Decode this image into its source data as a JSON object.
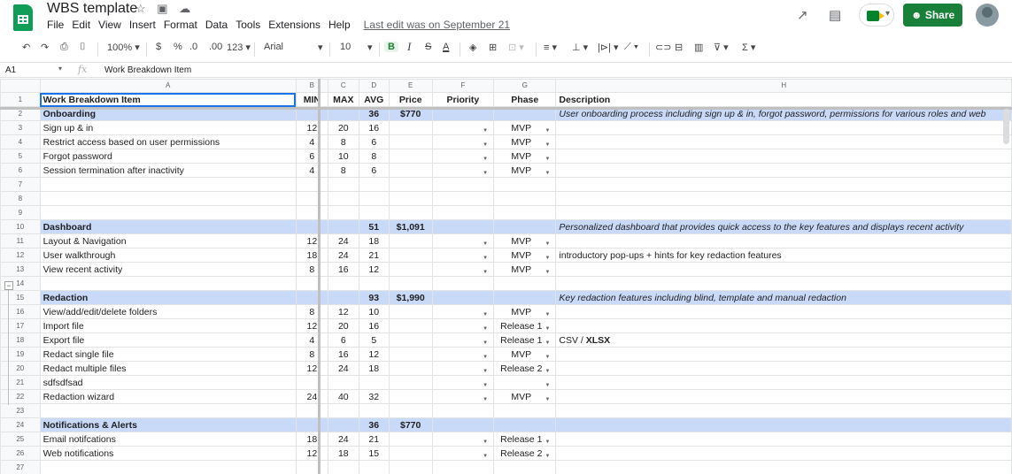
{
  "app": {
    "title": "WBS template",
    "menu": [
      "File",
      "Edit",
      "View",
      "Insert",
      "Format",
      "Data",
      "Tools",
      "Extensions",
      "Help"
    ],
    "last_edit": "Last edit was on September 21",
    "share_label": "Share"
  },
  "toolbar": {
    "zoom": "100%",
    "currency": "$",
    "percent": "%",
    "dec_decrease": ".0",
    "dec_increase": ".00",
    "format_more": "123",
    "font": "Arial",
    "font_size": "10",
    "bold": "B",
    "italic": "I",
    "strike": "S",
    "text_color": "A"
  },
  "formula_bar": {
    "cell_ref": "A1",
    "fx": "fx",
    "content": "Work Breakdown Item"
  },
  "columns": [
    "A",
    "B",
    "C",
    "D",
    "E",
    "F",
    "G",
    "H"
  ],
  "header_row": {
    "num": "1",
    "item": "Work Breakdown Item",
    "min": "MIN",
    "max": "MAX",
    "avg": "AVG",
    "price": "Price",
    "priority": "Priority",
    "phase": "Phase",
    "desc": "Description"
  },
  "rows": [
    {
      "num": "2",
      "section": true,
      "item": "Onboarding",
      "min": "",
      "max": "",
      "avg": "36",
      "price": "$770",
      "dd": false,
      "phase": "",
      "desc": "User onboarding process including sign up & in, forgot password, permissions for various roles and web",
      "desc_italic": true
    },
    {
      "num": "3",
      "item": "Sign up & in",
      "min": "12",
      "max": "20",
      "avg": "16",
      "price": "",
      "dd": true,
      "phase": "MVP",
      "desc": ""
    },
    {
      "num": "4",
      "item": "Restrict access based on user permissions",
      "min": "4",
      "max": "8",
      "avg": "6",
      "price": "",
      "dd": true,
      "phase": "MVP",
      "desc": ""
    },
    {
      "num": "5",
      "item": "Forgot password",
      "min": "6",
      "max": "10",
      "avg": "8",
      "price": "",
      "dd": true,
      "phase": "MVP",
      "desc": ""
    },
    {
      "num": "6",
      "item": "Session termination after inactivity",
      "min": "4",
      "max": "8",
      "avg": "6",
      "price": "",
      "dd": true,
      "phase": "MVP",
      "desc": ""
    },
    {
      "num": "7",
      "item": "",
      "min": "",
      "max": "",
      "avg": "",
      "price": "",
      "dd": false,
      "phase": "",
      "desc": ""
    },
    {
      "num": "8",
      "item": "",
      "min": "",
      "max": "",
      "avg": "",
      "price": "",
      "dd": false,
      "phase": "",
      "desc": ""
    },
    {
      "num": "9",
      "item": "",
      "min": "",
      "max": "",
      "avg": "",
      "price": "",
      "dd": false,
      "phase": "",
      "desc": ""
    },
    {
      "num": "10",
      "section": true,
      "item": "Dashboard",
      "min": "",
      "max": "",
      "avg": "51",
      "price": "$1,091",
      "dd": false,
      "phase": "",
      "desc": "Personalized dashboard that provides quick access to the key features and displays recent activity",
      "desc_italic": true
    },
    {
      "num": "11",
      "item": "Layout & Navigation",
      "min": "12",
      "max": "24",
      "avg": "18",
      "price": "",
      "dd": true,
      "phase": "MVP",
      "desc": ""
    },
    {
      "num": "12",
      "item": "User walkthrough",
      "min": "18",
      "max": "24",
      "avg": "21",
      "price": "",
      "dd": true,
      "phase": "MVP",
      "desc": "introductory pop-ups + hints for key redaction features"
    },
    {
      "num": "13",
      "item": "View recent activity",
      "min": "8",
      "max": "16",
      "avg": "12",
      "price": "",
      "dd": true,
      "phase": "MVP",
      "desc": ""
    },
    {
      "num": "14",
      "item": "",
      "min": "",
      "max": "",
      "avg": "",
      "price": "",
      "dd": false,
      "phase": "",
      "desc": ""
    },
    {
      "num": "15",
      "section": true,
      "item": "Redaction",
      "min": "",
      "max": "",
      "avg": "93",
      "price": "$1,990",
      "dd": false,
      "phase": "",
      "desc": "Key redaction features including blind, template and manual redaction",
      "desc_italic": true
    },
    {
      "num": "16",
      "item": "View/add/edit/delete folders",
      "min": "8",
      "max": "12",
      "avg": "10",
      "price": "",
      "dd": true,
      "phase": "MVP",
      "desc": ""
    },
    {
      "num": "17",
      "item": "Import file",
      "min": "12",
      "max": "20",
      "avg": "16",
      "price": "",
      "dd": true,
      "phase": "Release 1",
      "desc": ""
    },
    {
      "num": "18",
      "item": "Export file",
      "min": "4",
      "max": "6",
      "avg": "5",
      "price": "",
      "dd": true,
      "phase": "Release 1",
      "desc": "CSV / ",
      "desc_bold": "XLSX"
    },
    {
      "num": "19",
      "item": "Redact single file",
      "min": "8",
      "max": "16",
      "avg": "12",
      "price": "",
      "dd": true,
      "phase": "MVP",
      "desc": ""
    },
    {
      "num": "20",
      "item": "Redact multiple files",
      "min": "12",
      "max": "24",
      "avg": "18",
      "price": "",
      "dd": true,
      "phase": "Release 2",
      "desc": ""
    },
    {
      "num": "21",
      "item": "sdfsdfsad",
      "min": "",
      "max": "",
      "avg": "",
      "price": "",
      "dd": true,
      "phase": "",
      "desc": ""
    },
    {
      "num": "22",
      "item": "Redaction wizard",
      "min": "24",
      "max": "40",
      "avg": "32",
      "price": "",
      "dd": true,
      "phase": "MVP",
      "desc": ""
    },
    {
      "num": "23",
      "item": "",
      "min": "",
      "max": "",
      "avg": "",
      "price": "",
      "dd": false,
      "phase": "",
      "desc": ""
    },
    {
      "num": "24",
      "section": true,
      "item": "Notifications & Alerts",
      "min": "",
      "max": "",
      "avg": "36",
      "price": "$770",
      "dd": false,
      "phase": "",
      "desc": ""
    },
    {
      "num": "25",
      "item": "Email notifcations",
      "min": "18",
      "max": "24",
      "avg": "21",
      "price": "",
      "dd": true,
      "phase": "Release 1",
      "desc": ""
    },
    {
      "num": "26",
      "item": "Web notifications",
      "min": "12",
      "max": "18",
      "avg": "15",
      "price": "",
      "dd": true,
      "phase": "Release 2",
      "desc": ""
    },
    {
      "num": "27",
      "item": "",
      "min": "",
      "max": "",
      "avg": "",
      "price": "",
      "dd": false,
      "phase": "",
      "desc": ""
    }
  ],
  "colors": {
    "section_fill": "#c9daf8",
    "share_green": "#188038",
    "selection_blue": "#1a73e8"
  }
}
